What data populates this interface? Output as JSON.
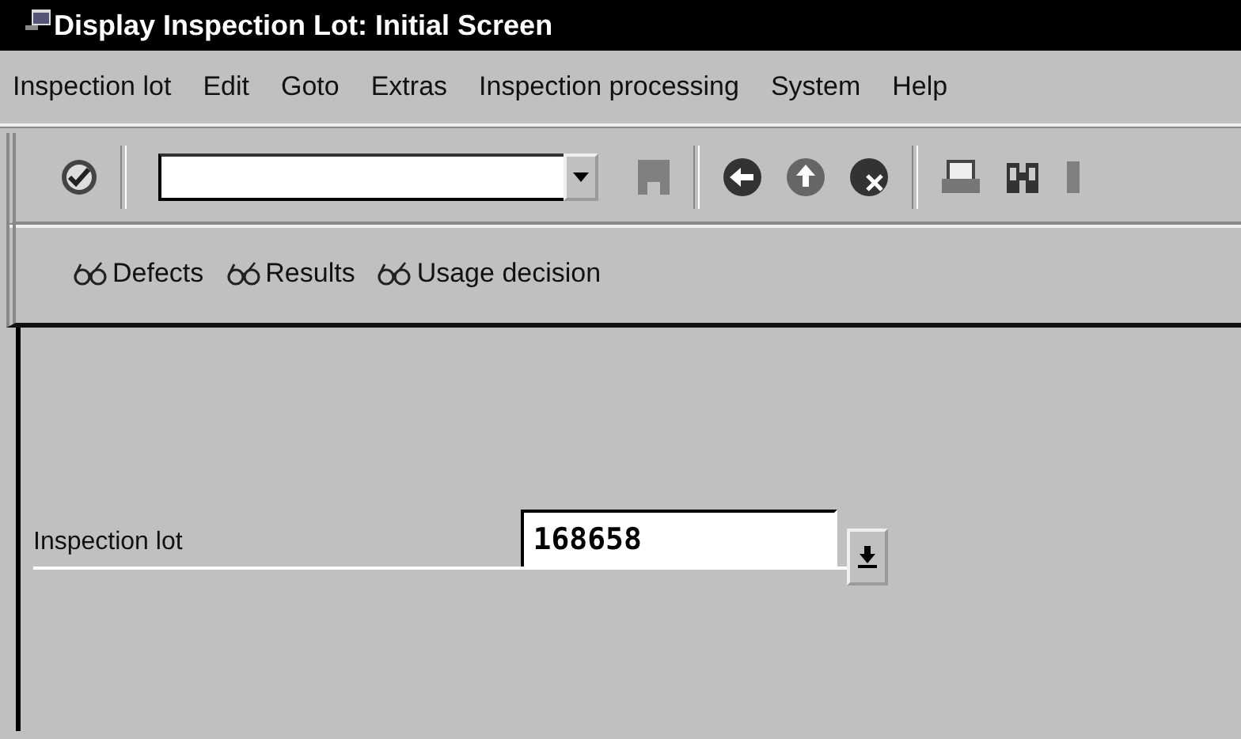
{
  "window": {
    "title": "Display Inspection Lot: Initial Screen"
  },
  "menu_bar": [
    {
      "label": "Inspection lot"
    },
    {
      "label": "Edit"
    },
    {
      "label": "Goto"
    },
    {
      "label": "Extras"
    },
    {
      "label": "Inspection processing"
    },
    {
      "label": "System"
    },
    {
      "label": "Help"
    }
  ],
  "standard_toolbar": {
    "buttons": [
      {
        "kind": "enter",
        "disabled": false
      },
      {
        "kind": "command_field"
      },
      {
        "kind": "save",
        "disabled": true
      },
      {
        "kind": "separator"
      },
      {
        "kind": "back",
        "disabled": false
      },
      {
        "kind": "exit",
        "disabled": false
      },
      {
        "kind": "cancel",
        "disabled": false
      },
      {
        "kind": "separator"
      },
      {
        "kind": "print",
        "disabled": false
      },
      {
        "kind": "find",
        "disabled": false
      },
      {
        "kind": "partial",
        "disabled": true
      }
    ]
  },
  "application_toolbar": [
    {
      "label": "Defects"
    },
    {
      "label": "Results"
    },
    {
      "label": "Usage decision"
    }
  ],
  "form": {
    "fields": [
      {
        "label": "Inspection lot",
        "value": "168658"
      }
    ]
  }
}
